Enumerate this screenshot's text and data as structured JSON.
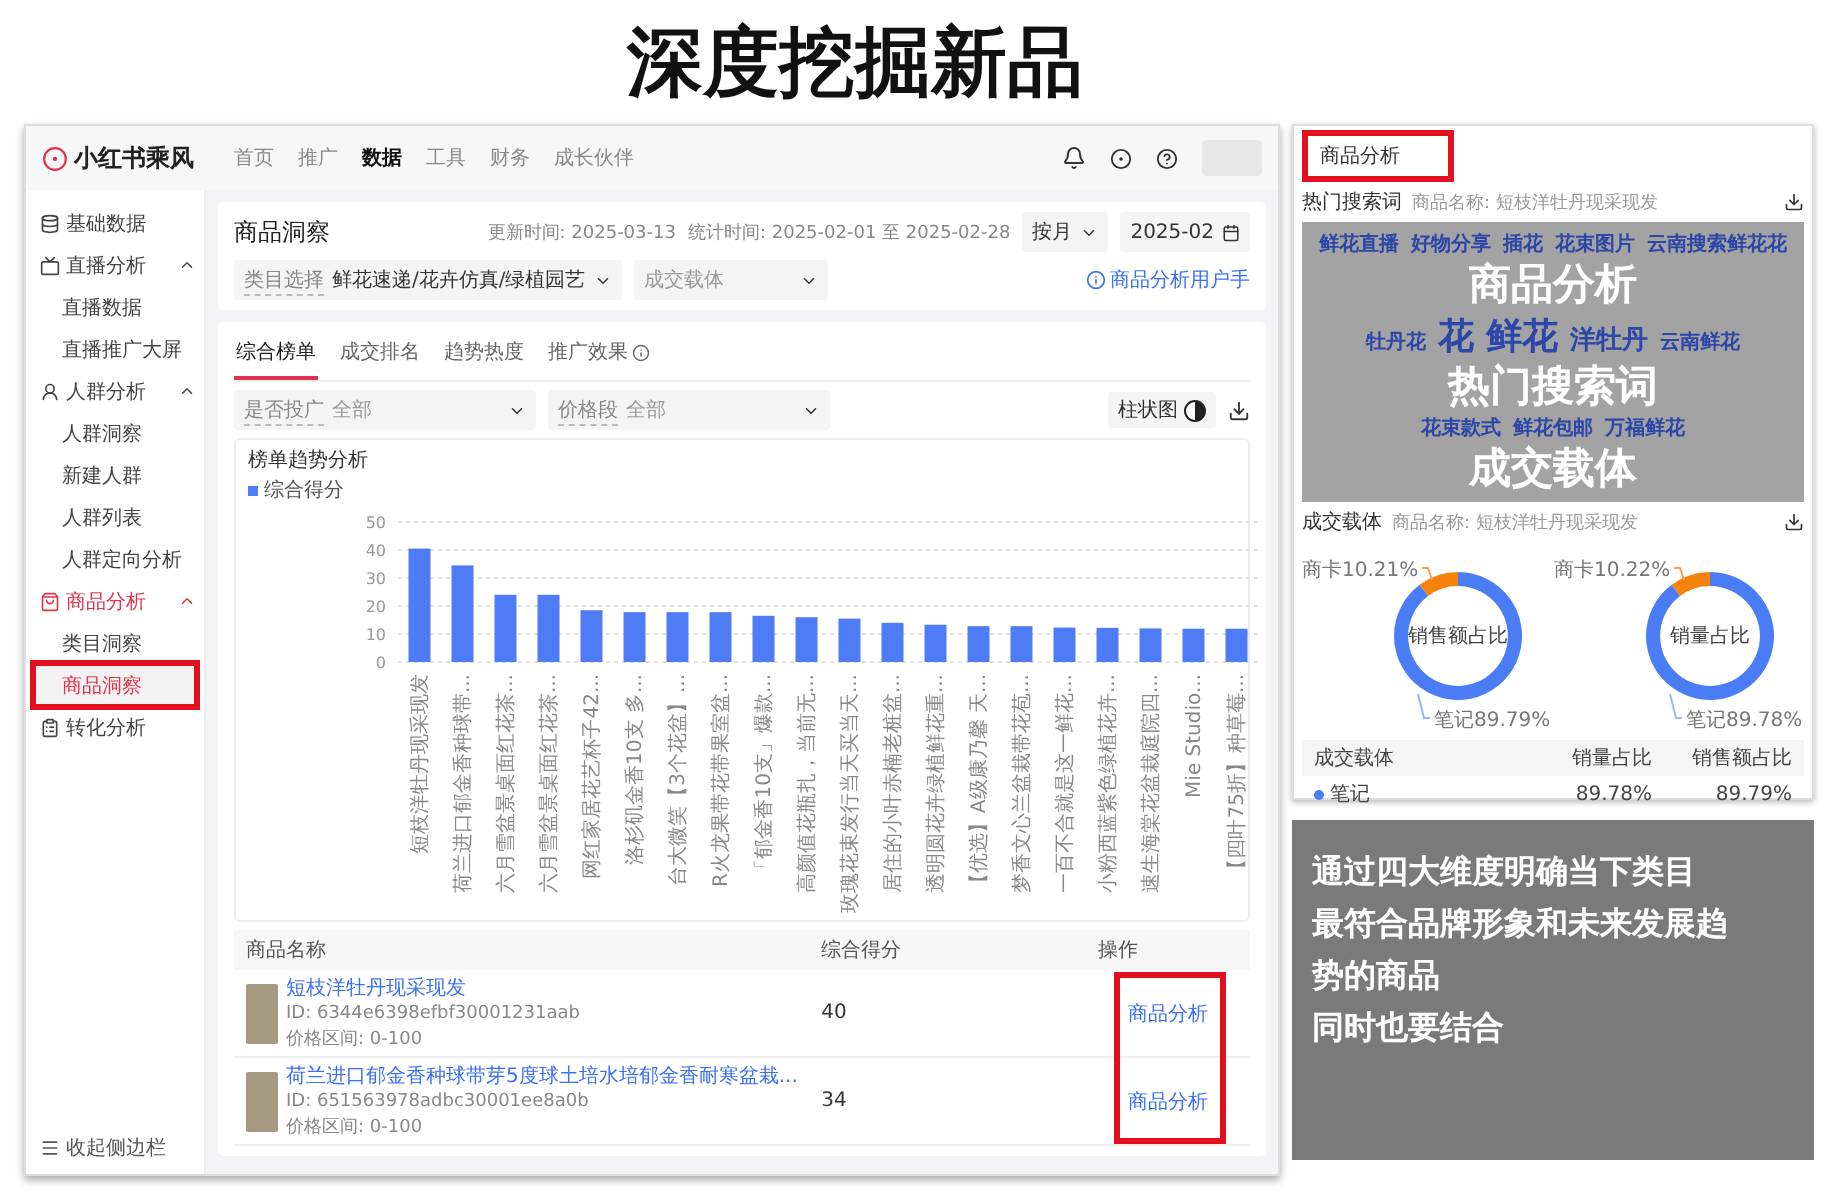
{
  "page_title": "深度挖掘新品",
  "app": {
    "logo": "小红书乘风",
    "nav": [
      {
        "label": "首页",
        "selected": false
      },
      {
        "label": "推广",
        "selected": false
      },
      {
        "label": "数据",
        "selected": true
      },
      {
        "label": "工具",
        "selected": false
      },
      {
        "label": "财务",
        "selected": false
      },
      {
        "label": "成长伙伴",
        "selected": false
      }
    ],
    "sidebar": {
      "items": [
        {
          "label": "基础数据",
          "selected": false,
          "highlighted": false
        },
        {
          "label": "直播分析",
          "selected": false,
          "highlighted": false,
          "expanded": true,
          "children": [
            {
              "label": "直播数据",
              "selected": false,
              "highlighted": false
            },
            {
              "label": "直播推广大屏",
              "selected": false,
              "highlighted": false
            }
          ]
        },
        {
          "label": "人群分析",
          "selected": false,
          "highlighted": false,
          "expanded": true,
          "children": [
            {
              "label": "人群洞察",
              "selected": false,
              "highlighted": false
            },
            {
              "label": "新建人群",
              "selected": false,
              "highlighted": false
            },
            {
              "label": "人群列表",
              "selected": false,
              "highlighted": false
            },
            {
              "label": "人群定向分析",
              "selected": false,
              "highlighted": false
            }
          ]
        },
        {
          "label": "商品分析",
          "selected": true,
          "highlighted": false,
          "expanded": true,
          "children": [
            {
              "label": "类目洞察",
              "selected": false,
              "highlighted": false
            },
            {
              "label": "商品洞察",
              "selected": true,
              "highlighted": true
            }
          ]
        },
        {
          "label": "转化分析",
          "selected": false,
          "highlighted": false
        }
      ],
      "collapse": "收起侧边栏"
    },
    "header": {
      "title": "商品洞察",
      "update_time": "更新时间: 2025-03-13",
      "stat_time": "统计时间: 2025-02-01 至 2025-02-28",
      "period": "按月",
      "date": "2025-02",
      "category_select": {
        "label": "类目选择",
        "value": "鲜花速递/花卉仿真/绿植园艺"
      },
      "carrier_select": {
        "placeholder": "成交载体"
      },
      "manual_link": "商品分析用户手"
    },
    "tabs": [
      {
        "label": "综合榜单",
        "selected": true
      },
      {
        "label": "成交排名",
        "selected": false
      },
      {
        "label": "趋势热度",
        "selected": false
      },
      {
        "label": "推广效果",
        "selected": false,
        "info": true
      }
    ],
    "filters": [
      {
        "label": "是否投广",
        "value": "全部"
      },
      {
        "label": "价格段",
        "value": "全部"
      }
    ],
    "chart_toggle": {
      "label": "柱状图",
      "on": true
    },
    "chart_card": {
      "title": "榜单趋势分析",
      "chart_data": {
        "type": "bar",
        "categories": [
          "短枝洋牡丹现采现发",
          "荷兰进口郁金香种球带...",
          "六月雪盆景桌面红花茶...",
          "六月雪盆景桌面红花茶...",
          "网红家居花艺杯子42...",
          "洛杉矶金香10支 多...",
          "台大微笑【3个花盆】...",
          "R火龙果带花带果室盆...",
          "「郁金香10支」爆款...",
          "高颜值花瓶扎，当前无...",
          "玫瑰花束发行当天买当天...",
          "居住的小叶赤楠老桩盆...",
          "透明圆花卉绿植鲜花重...",
          "【优选】A级康乃馨 天...",
          "梦香文心兰盆栽带花苞...",
          "一百不合就是这一鲜花...",
          "小粉西蓝紫色绿植花卉...",
          "速生海棠花盆栽庭院四...",
          "Mie Studio...",
          "【四叶75折】种草莓..."
        ],
        "series": [
          {
            "name": "综合得分",
            "color": "#4e7cf6",
            "values": [
              40.5,
              34.5,
              24,
              24,
              18.5,
              17.8,
              17.8,
              17.8,
              16.5,
              16,
              15.5,
              14,
              13.3,
              12.8,
              12.8,
              12.3,
              12.2,
              12,
              11.9,
              11.9
            ]
          }
        ],
        "ylim": [
          0,
          50
        ],
        "yticks": [
          0,
          10,
          20,
          30,
          40,
          50
        ],
        "grid": true
      }
    },
    "table": {
      "columns": [
        "商品名称",
        "综合得分",
        "操作"
      ],
      "action_highlighted": true,
      "rows": [
        {
          "name": "短枝洋牡丹现采现发",
          "id": "ID: 6344e6398efbf30001231aab",
          "price": "价格区间: 0-100",
          "score": "40",
          "action": "商品分析"
        },
        {
          "name": "荷兰进口郁金香种球带芽5度球土培水培郁金香耐寒盆栽...",
          "id": "ID: 651563978adbc30001ee8a0b",
          "price": "价格区间: 0-100",
          "score": "34",
          "action": "商品分析"
        }
      ]
    }
  },
  "right_panel": {
    "title": "商品分析",
    "highlighted": true,
    "hot_words": {
      "title": "热门搜索词",
      "product": "商品名称: 短枝洋牡丹现采现发",
      "rows": [
        {
          "words": [
            {
              "text": "鲜花直播",
              "kind": "small"
            },
            {
              "text": "好物分享",
              "kind": "small"
            },
            {
              "text": "插花",
              "kind": "small"
            },
            {
              "text": "花束图片",
              "kind": "small"
            },
            {
              "text": "云南搜索鲜花花",
              "kind": "small"
            }
          ],
          "overlay": "商品分析"
        },
        {
          "words": [
            {
              "text": "牡丹花",
              "kind": "small"
            },
            {
              "text": "花",
              "kind": "large"
            },
            {
              "text": "鲜花",
              "kind": "large"
            },
            {
              "text": "洋牡丹",
              "kind": "medium"
            },
            {
              "text": "云南鲜花",
              "kind": "small"
            }
          ],
          "overlay": "热门搜索词"
        },
        {
          "words": [
            {
              "text": "花束款式",
              "kind": "small"
            },
            {
              "text": "鲜花包邮",
              "kind": "small"
            },
            {
              "text": "万福鲜花",
              "kind": "small"
            }
          ],
          "overlay": "成交载体"
        }
      ]
    },
    "carrier": {
      "title": "成交载体",
      "product": "商品名称: 短枝洋牡丹现采现发",
      "donuts": [
        {
          "chart_data": {
            "type": "donut",
            "categories": [
              "商卡",
              "笔记"
            ],
            "series": [
              {
                "name": "销售额占比",
                "values": [
                  10.21,
                  89.79
                ]
              }
            ],
            "value_labels": [
              "10.21%",
              "89.79%"
            ],
            "colors": [
              "#f5820a",
              "#4a7cf5"
            ]
          }
        },
        {
          "chart_data": {
            "type": "donut",
            "categories": [
              "商卡",
              "笔记"
            ],
            "series": [
              {
                "name": "销量占比",
                "values": [
                  10.22,
                  89.78
                ]
              }
            ],
            "value_labels": [
              "10.22%",
              "89.78%"
            ],
            "colors": [
              "#f5820a",
              "#4a7cf5"
            ]
          }
        }
      ],
      "table": {
        "columns": [
          "成交载体",
          "销量占比",
          "销售额占比"
        ],
        "rows": [
          {
            "cells": [
              "笔记",
              "89.78%",
              "89.79%"
            ],
            "color": "#4a7cf5"
          }
        ]
      }
    }
  },
  "summary": [
    "通过四大维度明确当下类目",
    "最符合品牌形象和未来发展趋",
    "势的商品",
    "同时也要结合"
  ]
}
